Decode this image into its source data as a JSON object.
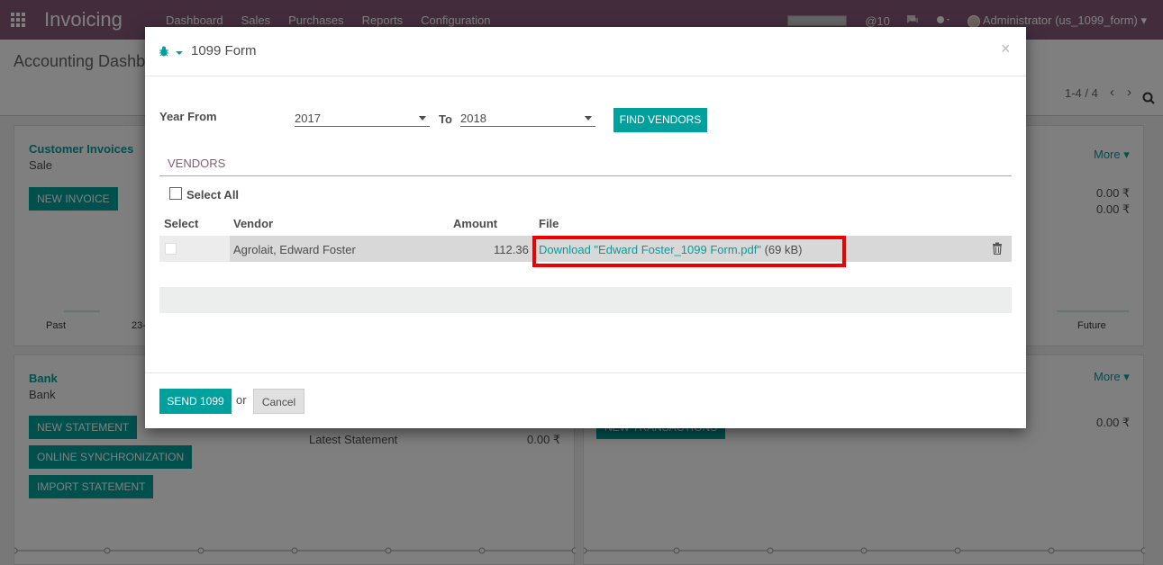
{
  "topbar": {
    "app_title": "Invoicing",
    "menu": [
      "Dashboard",
      "Sales",
      "Purchases",
      "Reports",
      "Configuration"
    ],
    "progress": 0.0,
    "mentions": "@10",
    "user": "Administrator (us_1099_form)"
  },
  "subheader": {
    "breadcrumb": "Accounting Dashb",
    "pager": "1-4 / 4"
  },
  "background": {
    "customer_invoices_title": "Customer Invoices",
    "customer_invoices_sub": "Sale",
    "new_invoice": "NEW INVOICE",
    "more": "More",
    "amount_a": "0.00 ₹",
    "amount_b": "0.00 ₹",
    "past": "Past",
    "date_fragment": "23-",
    "future": "Future",
    "bank_title": "Bank",
    "bank_sub": "Bank",
    "new_statement": "NEW STATEMENT",
    "online_sync": "ONLINE SYNCHRONIZATION",
    "import_statement": "IMPORT STATEMENT",
    "latest_statement": "Latest Statement",
    "latest_amount": "0.00 ₹",
    "new_transactions": "NEW TRANSACTIONS",
    "amount_c": "0.00 ₹"
  },
  "modal": {
    "title": "1099 Form",
    "close": "×",
    "year_from_label": "Year From",
    "year_from": "2017",
    "to_label": "To",
    "year_to": "2018",
    "find_vendors": "FIND VENDORS",
    "tab": "VENDORS",
    "select_all": "Select All",
    "headers": {
      "select": "Select",
      "vendor": "Vendor",
      "amount": "Amount",
      "file": "File"
    },
    "rows": [
      {
        "vendor": "Agrolait, Edward Foster",
        "amount": "112.36",
        "file_link": "Download \"Edward Foster_1099 Form.pdf\"",
        "file_size": "(69 kB)"
      }
    ],
    "send": "SEND 1099",
    "or": "or",
    "cancel": "Cancel"
  }
}
